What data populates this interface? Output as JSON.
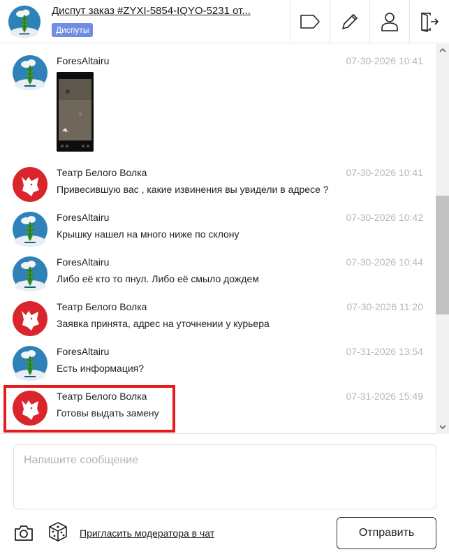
{
  "header": {
    "title": "Диспут заказ #ZYXI-5854-IQYO-5231 от...",
    "badge": "Диспуты",
    "actions": [
      {
        "icon": "tag-icon"
      },
      {
        "icon": "pencil-icon"
      },
      {
        "icon": "user-icon"
      },
      {
        "icon": "exit-door-icon"
      }
    ]
  },
  "messages": [
    {
      "author": "ForesAltairu",
      "time": "07-30-2026 10:41",
      "text": "",
      "avatar": "forest-avatar",
      "attachment": "photo-thumbnail"
    },
    {
      "author": "Театр Белого Волка",
      "time": "07-30-2026 10:41",
      "text": "Привесившую вас , какие извинения вы увидели в адресе ?",
      "avatar": "wolf-avatar"
    },
    {
      "author": "ForesAltairu",
      "time": "07-30-2026 10:42",
      "text": "Крышку нашел на много ниже по склону",
      "avatar": "forest-avatar"
    },
    {
      "author": "ForesAltairu",
      "time": "07-30-2026 10:44",
      "text": "Либо её кто то пнул. Либо её смыло дождем",
      "avatar": "forest-avatar"
    },
    {
      "author": "Театр Белого Волка",
      "time": "07-30-2026 11:20",
      "text": "Заявка принята, адрес на уточнении у курьера",
      "avatar": "wolf-avatar"
    },
    {
      "author": "ForesAltairu",
      "time": "07-31-2026 13:54",
      "text": "Есть информация?",
      "avatar": "forest-avatar"
    },
    {
      "author": "Театр Белого Волка",
      "time": "07-31-2026 15:49",
      "text": "Готовы выдать замену",
      "avatar": "wolf-avatar"
    }
  ],
  "composer": {
    "placeholder": "Напишите сообщение",
    "value": ""
  },
  "footer": {
    "camera_icon": "camera-icon",
    "dice_icon": "dice-icon",
    "invite_label": "Пригласить модератора в чат",
    "send_label": "Отправить"
  },
  "colors": {
    "badge": "#6f8ee3",
    "highlight": "#e51c1c",
    "timestamp": "#b7b7b7"
  }
}
